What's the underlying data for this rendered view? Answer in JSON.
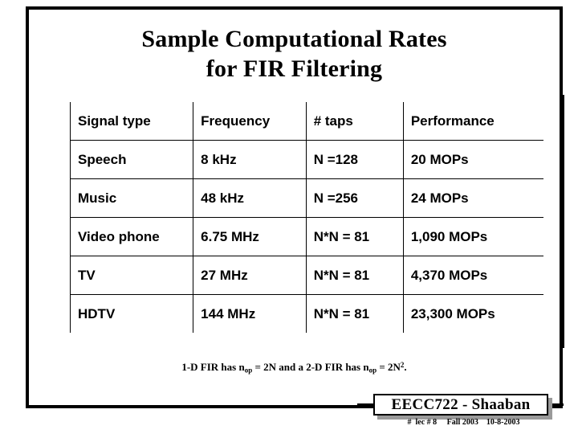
{
  "slide": {
    "title_line1": "Sample Computational Rates",
    "title_line2": "for FIR Filtering"
  },
  "table": {
    "headers": [
      "Signal type",
      "Frequency",
      "# taps",
      "Performance"
    ],
    "rows": [
      {
        "signal": "Speech",
        "frequency": "8 kHz",
        "taps": "N =128",
        "performance": "20 MOPs"
      },
      {
        "signal": "Music",
        "frequency": "48 kHz",
        "taps": "N =256",
        "performance": "24 MOPs"
      },
      {
        "signal": "Video phone",
        "frequency": "6.75 MHz",
        "taps": "N*N = 81",
        "performance": "1,090 MOPs"
      },
      {
        "signal": "TV",
        "frequency": "27 MHz",
        "taps": "N*N = 81",
        "performance": "4,370 MOPs"
      },
      {
        "signal": "HDTV",
        "frequency": "144 MHz",
        "taps": "N*N = 81",
        "performance": "23,300 MOPs"
      }
    ]
  },
  "footnote": {
    "part1": "1-D FIR has n",
    "sub1": "op",
    "part2": " = 2N and a 2-D FIR has n",
    "sub2": "op",
    "part3": " = 2N",
    "sup1": "2",
    "part4": "."
  },
  "footer": {
    "badge_label": "EECC722 - Shaaban",
    "meta": "#  lec # 8     Fall 2003    10-8-2003"
  },
  "colors": {
    "ink": "#000000",
    "paper": "#ffffff",
    "shadow": "#9a9a9a"
  }
}
